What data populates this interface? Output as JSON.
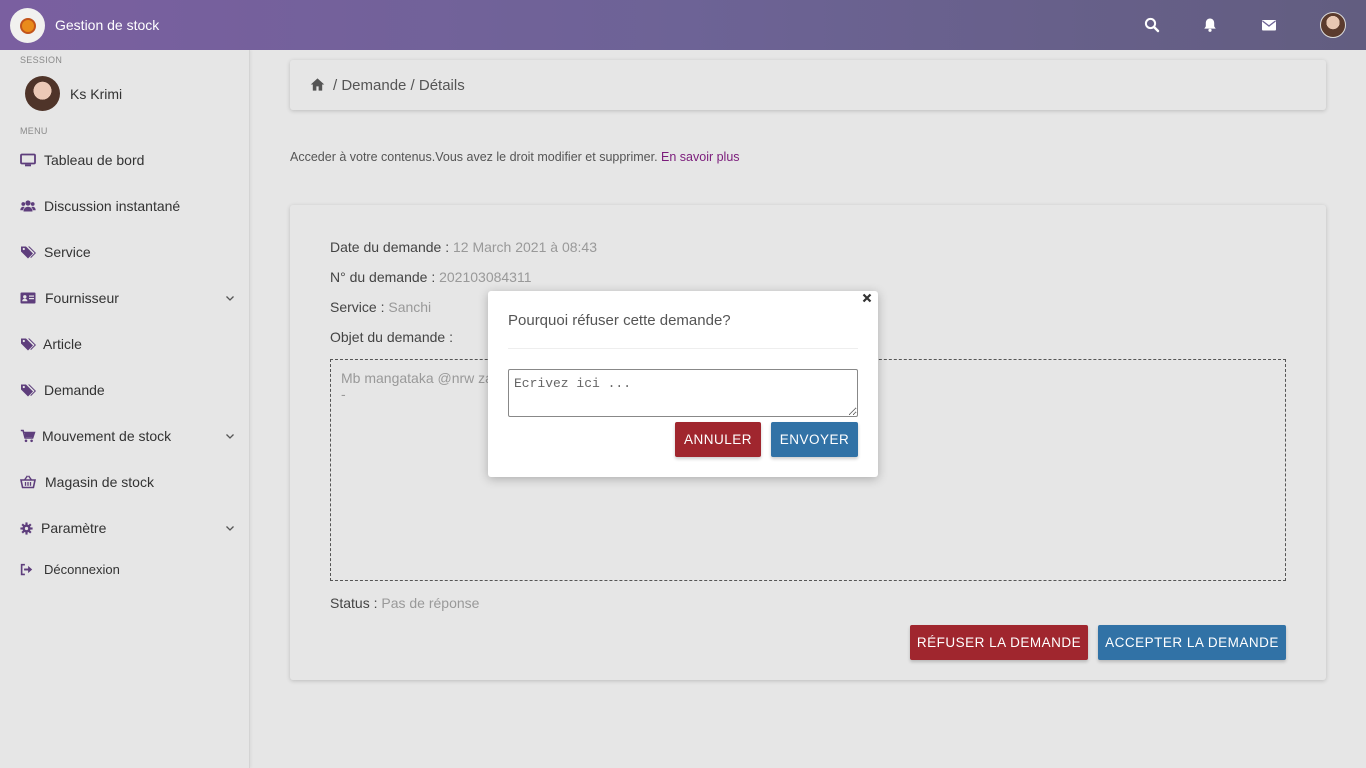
{
  "app": {
    "title": "Gestion de stock"
  },
  "topbar": {
    "icons": [
      "search-icon",
      "bell-icon",
      "envelope-icon"
    ],
    "accent_start": "#7a5fa0",
    "accent_end": "#625d80"
  },
  "sidebar": {
    "session_label": "SESSION",
    "user_name": "Ks Krimi",
    "menu_label": "MENU",
    "items": [
      {
        "label": "Tableau de bord",
        "icon": "desktop-icon"
      },
      {
        "label": "Discussion instantané",
        "icon": "users-icon"
      },
      {
        "label": "Service",
        "icon": "tags-icon"
      },
      {
        "label": "Fournisseur",
        "icon": "address-card-icon"
      },
      {
        "label": "Article",
        "icon": "tags-icon"
      },
      {
        "label": "Demande",
        "icon": "tags-icon"
      },
      {
        "label": "Mouvement de stock",
        "icon": "cart-icon"
      },
      {
        "label": "Magasin de stock",
        "icon": "basket-icon"
      },
      {
        "label": "Paramètre",
        "icon": "gear-icon"
      },
      {
        "label": "Déconnexion",
        "icon": "sign-out-icon"
      }
    ]
  },
  "breadcrumb": {
    "path": "/ Demande / Détails"
  },
  "info": {
    "text": "Acceder à votre contenus.Vous avez le droit modifier et supprimer. ",
    "link": "En savoir plus"
  },
  "demande": {
    "date_label": "Date du demande : ",
    "date_value": "12 March 2021 à 08:43",
    "num_label": "N° du demande : ",
    "num_value": "202103084311",
    "service_label": "Service : ",
    "service_value": "Sanchi",
    "objet_label": "Objet du demande :",
    "objet_value": "Mb mangataka @nrw za\n-",
    "status_label": "Status : ",
    "status_value": "Pas de réponse",
    "refuse_button": "RÉFUSER LA DEMANDE",
    "accept_button": "ACCEPTER LA DEMANDE"
  },
  "modal": {
    "title": "Pourquoi réfuser cette demande?",
    "textarea_placeholder": "Ecrivez ici ...",
    "cancel_button": "ANNULER",
    "send_button": "ENVOYER"
  },
  "colors": {
    "primary_blue": "#3172a6",
    "danger_red": "#a0262e",
    "link_purple": "#7b1c7b",
    "icon_purple": "#5e3e7c"
  }
}
